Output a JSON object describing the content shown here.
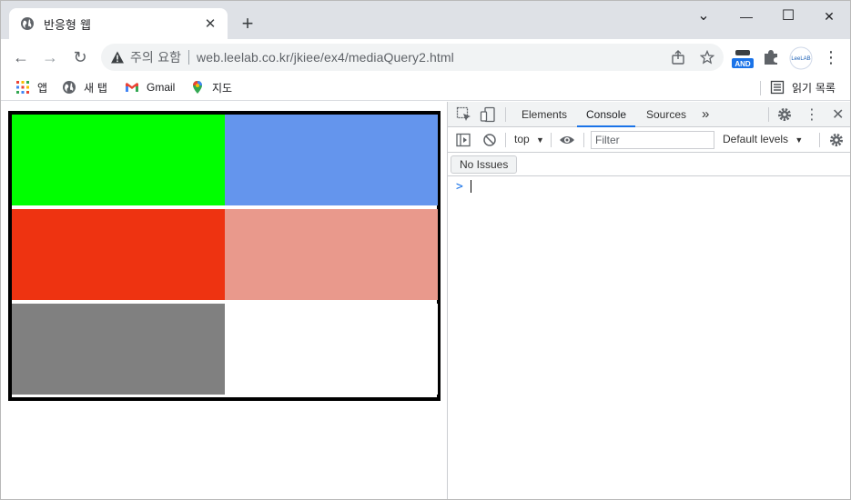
{
  "tab": {
    "title": "반응형 웹",
    "close": "✕"
  },
  "newtab": "+",
  "window": {
    "minimize": "—",
    "maximize": "☐",
    "close": "✕",
    "dropdown": "⌄"
  },
  "toolbar": {
    "back": "←",
    "forward": "→",
    "reload": "↻",
    "security_label": "주의 요함",
    "url": "web.leelab.co.kr/jkiee/ex4/mediaQuery2.html",
    "ext_and_label": "AND",
    "profile_label": "LeeLAB",
    "menu": "⋮"
  },
  "bookmarks": {
    "apps": "앱",
    "newtab": "새 탭",
    "gmail": "Gmail",
    "maps": "지도",
    "reading_list": "읽기 목록"
  },
  "page": {
    "boxes": [
      {
        "color": "#00ff00"
      },
      {
        "color": "#6495ed"
      },
      {
        "color": "#ee3311"
      },
      {
        "color": "#e9998c"
      },
      {
        "color": "#808080"
      },
      {
        "color": "#ffffff"
      }
    ]
  },
  "devtools": {
    "tabs": [
      "Elements",
      "Console",
      "Sources"
    ],
    "active_tab": "Console",
    "more": "»",
    "context": "top",
    "filter_placeholder": "Filter",
    "levels": "Default levels",
    "no_issues": "No Issues",
    "prompt": ">"
  },
  "colors": {
    "accent": "#1a73e8",
    "tabstrip": "#dee1e6",
    "omnibox": "#f1f3f4"
  }
}
